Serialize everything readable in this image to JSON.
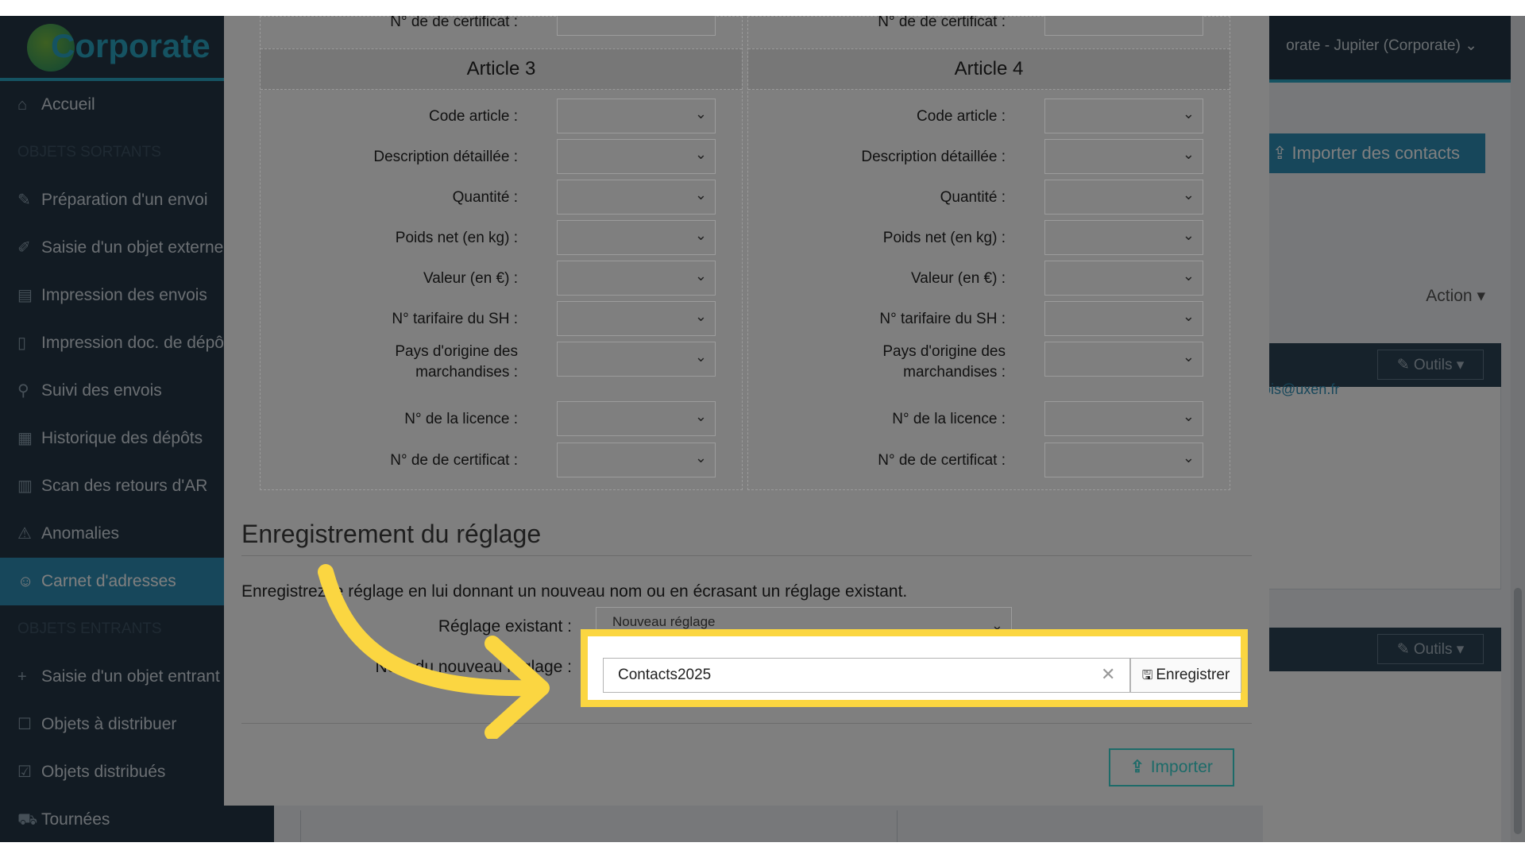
{
  "sidebar": {
    "logo_text": "Corporate",
    "items": [
      {
        "label": "Accueil",
        "icon": "home-icon"
      },
      {
        "section": "OBJETS SORTANTS"
      },
      {
        "label": "Préparation d'un envoi",
        "icon": "pencil-icon"
      },
      {
        "label": "Saisie d'un objet externe",
        "icon": "edit-icon"
      },
      {
        "label": "Impression des envois",
        "icon": "printer-icon"
      },
      {
        "label": "Impression doc. de dépôt",
        "icon": "document-icon"
      },
      {
        "label": "Suivi des envois",
        "icon": "search-icon"
      },
      {
        "label": "Historique des dépôts",
        "icon": "calendar-icon"
      },
      {
        "label": "Scan des retours d'AR",
        "icon": "barcode-icon"
      },
      {
        "label": "Anomalies",
        "icon": "warning-icon"
      },
      {
        "label": "Carnet d'adresses",
        "icon": "users-icon",
        "active": true
      },
      {
        "section": "OBJETS ENTRANTS"
      },
      {
        "label": "Saisie d'un objet entrant",
        "icon": "plus-icon"
      },
      {
        "label": "Objets à distribuer",
        "icon": "checkbox-icon"
      },
      {
        "label": "Objets distribués",
        "icon": "checked-icon"
      },
      {
        "label": "Tournées",
        "icon": "cart-icon"
      }
    ]
  },
  "background": {
    "user_menu": "orate - Jupiter (Corporate)",
    "import_contacts": "Importer des contacts",
    "action": "Action",
    "tools": "Outils",
    "email": "ois@uxen.fr"
  },
  "modal": {
    "prev_row_label": "N° de de certificat :",
    "articles": [
      {
        "title": "Article 3"
      },
      {
        "title": "Article 4"
      }
    ],
    "field_labels": {
      "code": "Code article :",
      "description": "Description détaillée :",
      "quantity": "Quantité :",
      "weight": "Poids net (en kg) :",
      "value": "Valeur (en €) :",
      "hs": "N° tarifaire du SH :",
      "origin_line1": "Pays d'origine des",
      "origin_line2": "marchandises :",
      "license": "N° de la licence :",
      "certificate": "N° de de certificat :"
    },
    "save_section": {
      "title": "Enregistrement du réglage",
      "description": "Enregistrez le réglage en lui donnant un nouveau nom ou en écrasant un réglage existant.",
      "existing_label": "Réglage existant :",
      "existing_value": "Nouveau réglage",
      "name_label": "Nom du nouveau réglage :",
      "name_value": "Contacts2025",
      "save_label": "Enregistrer"
    },
    "import_label": "Importer"
  },
  "colors": {
    "highlight": "#fbd641",
    "sidebar": "#253746",
    "accent": "#2f8fb6"
  }
}
